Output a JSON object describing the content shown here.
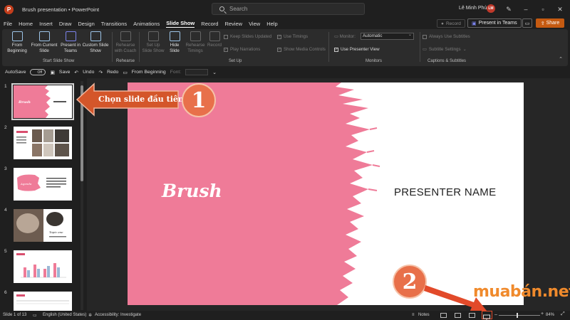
{
  "titlebar": {
    "app_logo": "P",
    "doc_title": "Brush presentation  •  PowerPoint",
    "search_placeholder": "Search",
    "user_name": "Lê Minh Phú",
    "user_initials": "LM"
  },
  "tabs": [
    "File",
    "Home",
    "Insert",
    "Draw",
    "Design",
    "Transitions",
    "Animations",
    "Slide Show",
    "Record",
    "Review",
    "View",
    "Help"
  ],
  "active_tab": "Slide Show",
  "tab_actions": {
    "record": "Record",
    "present_in_teams": "Present in Teams",
    "share": "Share"
  },
  "ribbon": {
    "from_beginning": "From Beginning",
    "from_current": "From Current Slide",
    "present_teams": "Present in Teams",
    "custom_show": "Custom Slide Show",
    "group_start": "Start Slide Show",
    "rehearse": "Rehearse with Coach",
    "group_rehearse": "Rehearse",
    "setup_show": "Set Up Slide Show",
    "hide_slide": "Hide Slide",
    "rehearse_timings": "Rehearse Timings",
    "record": "Record",
    "keep_updated": "Keep Slides Updated",
    "play_narrations": "Play Narrations",
    "use_timings": "Use Timings",
    "show_media": "Show Media Controls",
    "group_setup": "Set Up",
    "monitor_label": "Monitor:",
    "monitor_value": "Automatic",
    "presenter_view": "Use Presenter View",
    "group_monitors": "Monitors",
    "always_subtitles": "Always Use Subtitles",
    "subtitle_settings": "Subtitle Settings",
    "group_captions": "Captions & Subtitles"
  },
  "qat": {
    "autosave": "AutoSave",
    "toggle_state": "Off",
    "save": "Save",
    "undo": "Undo",
    "redo": "Redo",
    "from_beginning": "From Beginning",
    "font_label": "Font:"
  },
  "thumbnails": [
    "1",
    "2",
    "3",
    "4",
    "5",
    "6"
  ],
  "slide": {
    "title": "Brush",
    "presenter": "PRESENTER NAME",
    "accent_color": "#ef7b98"
  },
  "callouts": {
    "step1_text": "Chọn slide đầu tiên",
    "step1_num": "1",
    "step2_num": "2",
    "watermark": "muabán.net"
  },
  "status": {
    "slide_count": "Slide 1 of 13",
    "language": "English (United States)",
    "accessibility": "Accessibility: Investigate",
    "notes": "Notes",
    "zoom": "84%"
  }
}
